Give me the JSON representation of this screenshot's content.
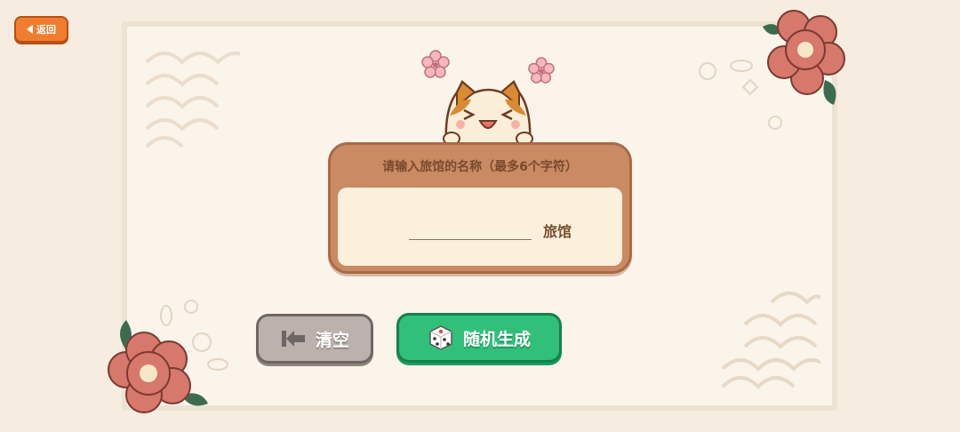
{
  "header": {
    "back_label": "返回"
  },
  "dialog": {
    "title": "请输入旅馆的名称（最多6个字符）",
    "name_value": "",
    "suffix": "旅馆"
  },
  "buttons": {
    "clear_label": "清空",
    "random_label": "随机生成"
  },
  "colors": {
    "background": "#f6ece0",
    "back_button": "#f07d2e",
    "clear_button": "#bdb1ad",
    "random_button": "#31c07a",
    "card": "#c98a64",
    "flower": "#d6786b"
  }
}
